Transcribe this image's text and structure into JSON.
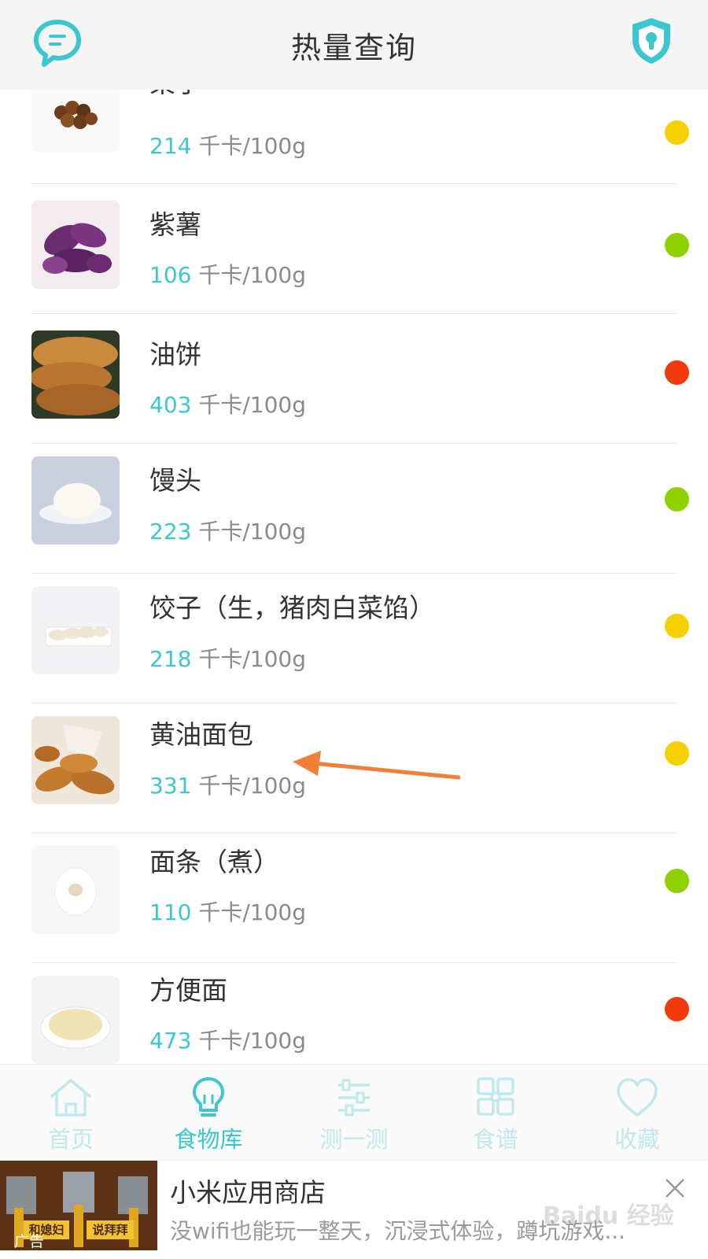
{
  "header": {
    "title": "热量查询",
    "left_icon": "chat-bubble-icon",
    "right_icon": "shield-lock-icon",
    "accent": "#3cc6cf"
  },
  "unit": "千卡/100g",
  "foods": [
    {
      "name": "栗子",
      "calories": "214",
      "level_color": "#f5d000"
    },
    {
      "name": "紫薯",
      "calories": "106",
      "level_color": "#8fd100"
    },
    {
      "name": "油饼",
      "calories": "403",
      "level_color": "#f23a0c"
    },
    {
      "name": "馒头",
      "calories": "223",
      "level_color": "#8fd100"
    },
    {
      "name": "饺子（生，猪肉白菜馅）",
      "calories": "218",
      "level_color": "#f5d000"
    },
    {
      "name": "黄油面包",
      "calories": "331",
      "level_color": "#f5d000"
    },
    {
      "name": "面条（煮）",
      "calories": "110",
      "level_color": "#8fd100"
    },
    {
      "name": "方便面",
      "calories": "473",
      "level_color": "#f23a0c"
    }
  ],
  "tabs": [
    {
      "label": "首页",
      "icon": "home-icon",
      "active": false
    },
    {
      "label": "食物库",
      "icon": "lightbulb-icon",
      "active": true
    },
    {
      "label": "测一测",
      "icon": "sliders-icon",
      "active": false
    },
    {
      "label": "食谱",
      "icon": "grid-icon",
      "active": false
    },
    {
      "label": "收藏",
      "icon": "heart-icon",
      "active": false
    }
  ],
  "ad": {
    "title": "小米应用商店",
    "description": "没wifi也能玩一整天，沉浸式体验，蹲坑游戏...",
    "tag": "广告",
    "image_text_1": "和媳妇",
    "image_text_2": "说拜拜"
  },
  "watermark": "Baidu 经验"
}
